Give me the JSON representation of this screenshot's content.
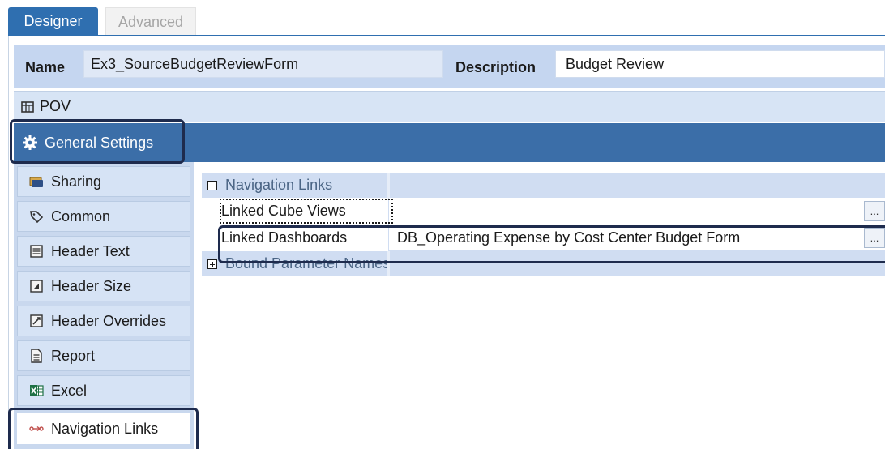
{
  "tabs": [
    {
      "label": "Designer",
      "active": true
    },
    {
      "label": "Advanced",
      "active": false
    }
  ],
  "name_row": {
    "name_label": "Name",
    "name_value": "Ex3_SourceBudgetReviewForm",
    "description_label": "Description",
    "description_value": "Budget Review"
  },
  "sections": {
    "pov": "POV",
    "general_settings": "General Settings"
  },
  "sidebar": {
    "items": [
      {
        "label": "Sharing",
        "icon": "sharing-icon"
      },
      {
        "label": "Common",
        "icon": "tag-icon"
      },
      {
        "label": "Header Text",
        "icon": "header-text-icon"
      },
      {
        "label": "Header Size",
        "icon": "header-size-icon"
      },
      {
        "label": "Header Overrides",
        "icon": "header-overrides-icon"
      },
      {
        "label": "Report",
        "icon": "report-icon"
      },
      {
        "label": "Excel",
        "icon": "excel-icon"
      },
      {
        "label": "Navigation Links",
        "icon": "navigation-links-icon",
        "active": true
      }
    ]
  },
  "property_grid": {
    "category_navigation": "Navigation Links",
    "linked_cube_views_label": "Linked Cube Views",
    "linked_cube_views_value": "",
    "linked_dashboards_label": "Linked Dashboards",
    "linked_dashboards_value": "DB_Operating Expense by Cost Center Budget Form",
    "ellipsis": "...",
    "category_bound": "Bound Parameter Names"
  },
  "colors": {
    "accent_blue": "#2f6fb0",
    "section_bar": "#3b6ea8",
    "highlight_border": "#1e2b4d"
  }
}
